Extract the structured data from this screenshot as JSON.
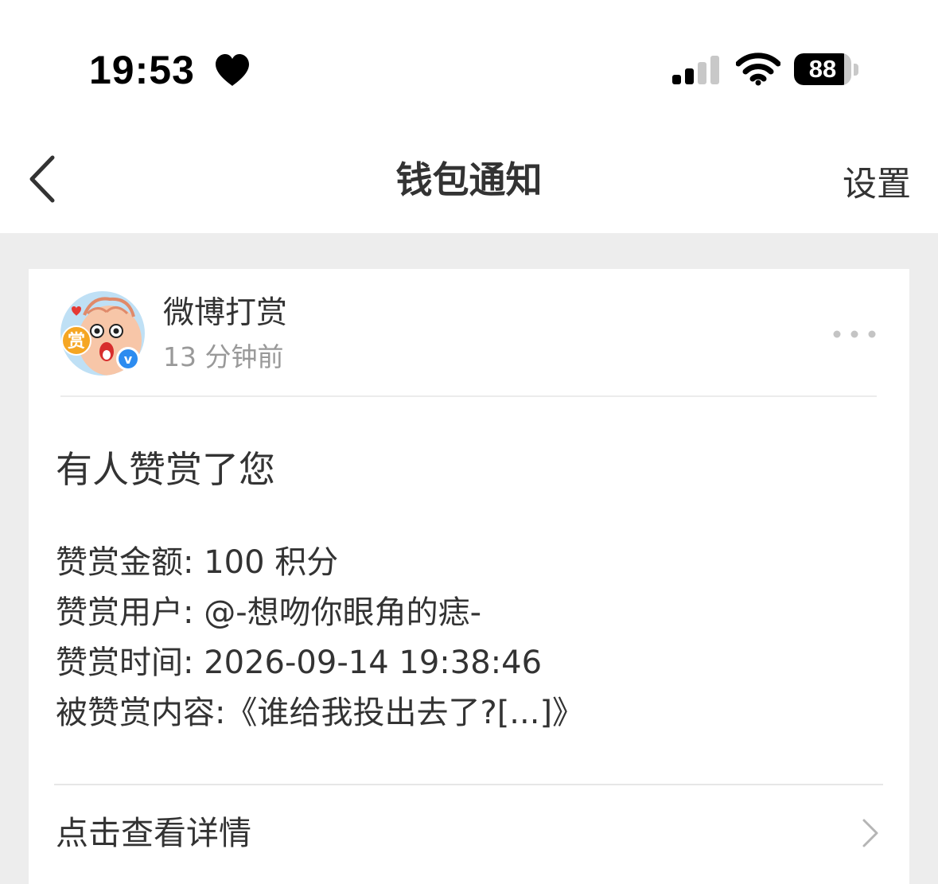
{
  "status_bar": {
    "time": "19:53",
    "heart_icon": "heart-icon",
    "signal_icon": "signal-icon",
    "wifi_icon": "wifi-icon",
    "battery_level": "88",
    "battery_fraction": 0.88
  },
  "nav": {
    "back_icon": "chevron-left-icon",
    "title": "钱包通知",
    "settings_label": "设置"
  },
  "notification": {
    "sender": "微博打赏",
    "time_ago": "13 分钟前",
    "avatar_badge": "赏",
    "verified_badge": "v",
    "more_icon": "more-dots-icon",
    "title": "有人赞赏了您",
    "details": [
      "赞赏金额: 100 积分",
      "赞赏用户: @-想吻你眼角的痣-",
      "赞赏时间: 2026-09-14 19:38:46",
      "被赞赏内容:《谁给我投出去了?[...]》"
    ],
    "view_details_label": "点击查看详情",
    "view_details_icon": "chevron-right-icon"
  },
  "colors": {
    "background": "#ededed",
    "card": "#ffffff",
    "text_primary": "#333333",
    "text_secondary": "#999999",
    "verified_blue": "#2d8cf0",
    "badge_orange": "#f5a623"
  }
}
